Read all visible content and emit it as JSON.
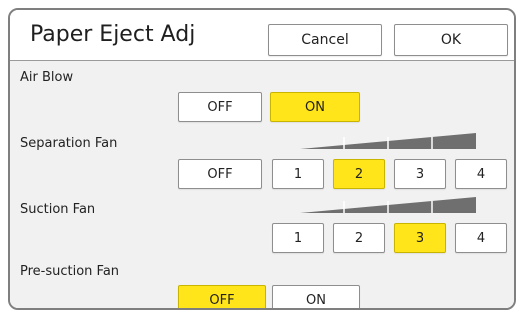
{
  "dialog": {
    "title": "Paper Eject Adj",
    "cancel_label": "Cancel",
    "ok_label": "OK"
  },
  "air_blow": {
    "label": "Air Blow",
    "options": [
      "OFF",
      "ON"
    ],
    "selected": "ON"
  },
  "separation_fan": {
    "label": "Separation Fan",
    "options": [
      "OFF",
      "1",
      "2",
      "3",
      "4"
    ],
    "selected": "2"
  },
  "suction_fan": {
    "label": "Suction Fan",
    "options": [
      "1",
      "2",
      "3",
      "4"
    ],
    "selected": "3"
  },
  "pre_suction_fan": {
    "label": "Pre-suction Fan",
    "options": [
      "OFF",
      "ON"
    ],
    "selected": "OFF"
  },
  "icons": {
    "level_ramp": "level-ramp-icon"
  },
  "colors": {
    "selected": "#ffe51a",
    "ramp_fill": "#6f6f6f",
    "frame": "#7f7f7f",
    "background": "#f1f1f1"
  }
}
